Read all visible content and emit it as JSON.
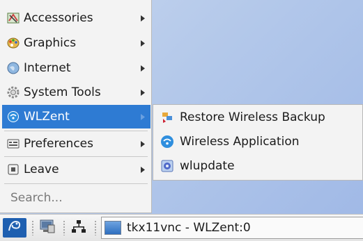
{
  "menu": {
    "items": [
      {
        "label": "Accessories",
        "icon": "accessories-icon"
      },
      {
        "label": "Graphics",
        "icon": "graphics-icon"
      },
      {
        "label": "Internet",
        "icon": "internet-icon"
      },
      {
        "label": "System Tools",
        "icon": "system-tools-icon"
      },
      {
        "label": "WLZent",
        "icon": "wlzent-icon"
      },
      {
        "label": "Preferences",
        "icon": "preferences-icon"
      },
      {
        "label": "Leave",
        "icon": "leave-icon"
      }
    ],
    "search_placeholder": "Search...",
    "active_color": "#2e7bd3"
  },
  "submenu": {
    "items": [
      {
        "label": "Restore Wireless Backup",
        "icon": "restore-icon"
      },
      {
        "label": "Wireless Application",
        "icon": "wireless-app-icon"
      },
      {
        "label": "wlupdate",
        "icon": "update-icon"
      }
    ]
  },
  "taskbar": {
    "window_title": "tkx11vnc - WLZent:0"
  }
}
